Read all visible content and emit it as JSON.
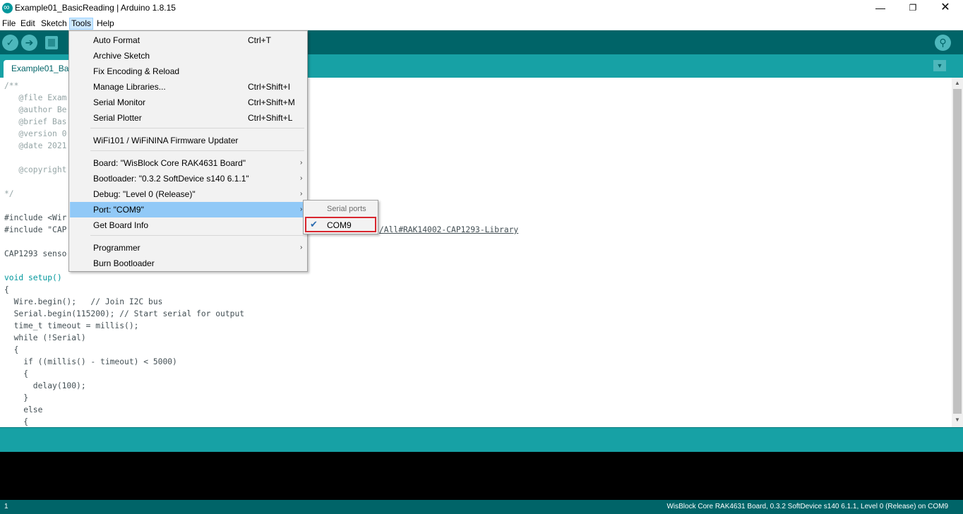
{
  "window": {
    "title": "Example01_BasicReading | Arduino 1.8.15",
    "minimize": "—",
    "maximize": "❐",
    "close": "✕"
  },
  "menubar": [
    "File",
    "Edit",
    "Sketch",
    "Tools",
    "Help"
  ],
  "toolbar": {
    "verify_icon": "check-icon",
    "upload_icon": "arrow-right-icon",
    "new_icon": "document-icon",
    "serial_monitor_icon": "magnifier-icon"
  },
  "tab": {
    "label": "Example01_Basi",
    "dropdown": "▼"
  },
  "code_lines": [
    {
      "text": "/**",
      "cls": "c-comment"
    },
    {
      "text": "   @file Exam",
      "cls": "c-comment"
    },
    {
      "text": "   @author Be",
      "cls": "c-comment"
    },
    {
      "text": "   @brief Bas",
      "cls": "c-comment"
    },
    {
      "text": "   @version 0",
      "cls": "c-comment"
    },
    {
      "text": "   @date 2021",
      "cls": "c-comment"
    },
    {
      "text": "",
      "cls": ""
    },
    {
      "text": "   @copyright",
      "cls": "c-comment"
    },
    {
      "text": "",
      "cls": ""
    },
    {
      "text": "*/",
      "cls": "c-comment"
    },
    {
      "text": "",
      "cls": ""
    },
    {
      "text": "#include <Wir",
      "cls": ""
    },
    {
      "text": "#include \"CAP",
      "cls": ""
    },
    {
      "text": "",
      "cls": ""
    },
    {
      "text": "CAP1293 senso",
      "cls": ""
    },
    {
      "text": "",
      "cls": ""
    },
    {
      "text": "void setup()",
      "cls": "c-type"
    },
    {
      "text": "{",
      "cls": ""
    },
    {
      "text": "  Wire.begin();   // Join I2C bus",
      "cls": ""
    },
    {
      "text": "  Serial.begin(115200); // Start serial for output",
      "cls": ""
    },
    {
      "text": "  time_t timeout = millis();",
      "cls": ""
    },
    {
      "text": "  while (!Serial)",
      "cls": ""
    },
    {
      "text": "  {",
      "cls": ""
    },
    {
      "text": "    if ((millis() - timeout) < 5000)",
      "cls": ""
    },
    {
      "text": "    {",
      "cls": ""
    },
    {
      "text": "      delay(100);",
      "cls": ""
    },
    {
      "text": "    }",
      "cls": ""
    },
    {
      "text": "    else",
      "cls": ""
    },
    {
      "text": "    {",
      "cls": ""
    }
  ],
  "code_link": "/All#RAK14002-CAP1293-Library",
  "tools_menu": {
    "items": [
      {
        "label": "Auto Format",
        "shortcut": "Ctrl+T"
      },
      {
        "label": "Archive Sketch",
        "shortcut": ""
      },
      {
        "label": "Fix Encoding & Reload",
        "shortcut": ""
      },
      {
        "label": "Manage Libraries...",
        "shortcut": "Ctrl+Shift+I"
      },
      {
        "label": "Serial Monitor",
        "shortcut": "Ctrl+Shift+M"
      },
      {
        "label": "Serial Plotter",
        "shortcut": "Ctrl+Shift+L"
      },
      {
        "label": "WiFi101 / WiFiNINA Firmware Updater",
        "shortcut": ""
      },
      {
        "label": "Board: \"WisBlock Core RAK4631 Board\"",
        "shortcut": ""
      },
      {
        "label": "Bootloader: \"0.3.2 SoftDevice s140 6.1.1\"",
        "shortcut": ""
      },
      {
        "label": "Debug: \"Level 0 (Release)\"",
        "shortcut": ""
      },
      {
        "label": "Port: \"COM9\"",
        "shortcut": ""
      },
      {
        "label": "Get Board Info",
        "shortcut": ""
      },
      {
        "label": "Programmer",
        "shortcut": ""
      },
      {
        "label": "Burn Bootloader",
        "shortcut": ""
      }
    ],
    "arrow": "›"
  },
  "port_submenu": {
    "header": "Serial ports",
    "item": "COM9",
    "check": "✔"
  },
  "status": {
    "line": "1",
    "board": "WisBlock Core RAK4631 Board, 0.3.2 SoftDevice s140 6.1.1, Level 0 (Release) on COM9"
  }
}
